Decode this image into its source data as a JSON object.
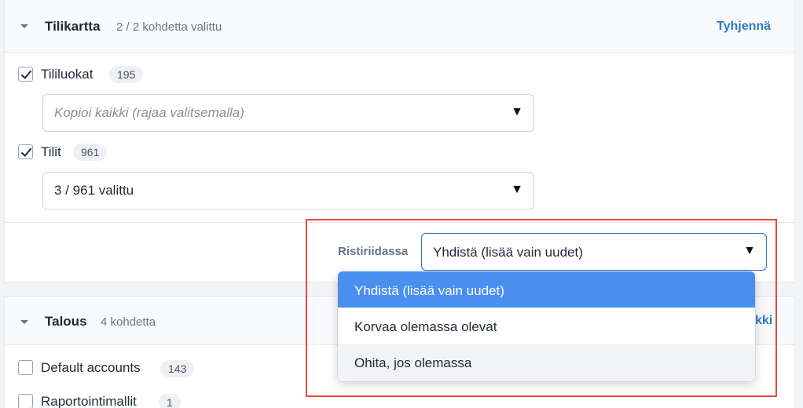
{
  "panel1": {
    "title": "Tilikartta",
    "subtitle": "2 / 2 kohdetta valittu",
    "clear_link": "Tyhjennä",
    "rows": [
      {
        "label": "Tililuokat",
        "count": "195",
        "checked": true,
        "select_placeholder": "Kopioi kaikki (rajaa valitsemalla)"
      },
      {
        "label": "Tilit",
        "count": "961",
        "checked": true,
        "select_value": "3 / 961 valittu"
      }
    ],
    "arrow_glyph": "▼"
  },
  "conflict": {
    "label": "Ristiriidassa",
    "selected": "Yhdistä (lisää vain uudet)",
    "options": [
      "Yhdistä (lisää vain uudet)",
      "Korvaa olemassa olevat",
      "Ohita, jos olemassa"
    ]
  },
  "panel2": {
    "title": "Talous",
    "subtitle": "4 kohdetta",
    "link_partial": "kki",
    "rows": [
      {
        "label": "Default accounts",
        "count": "143",
        "checked": false
      },
      {
        "label": "Raportointimallit",
        "count": "1",
        "checked": false
      }
    ]
  },
  "colors": {
    "accent": "#2b7bc2",
    "selected_option": "#4a8ff0",
    "annotation": "#e74c3c"
  }
}
